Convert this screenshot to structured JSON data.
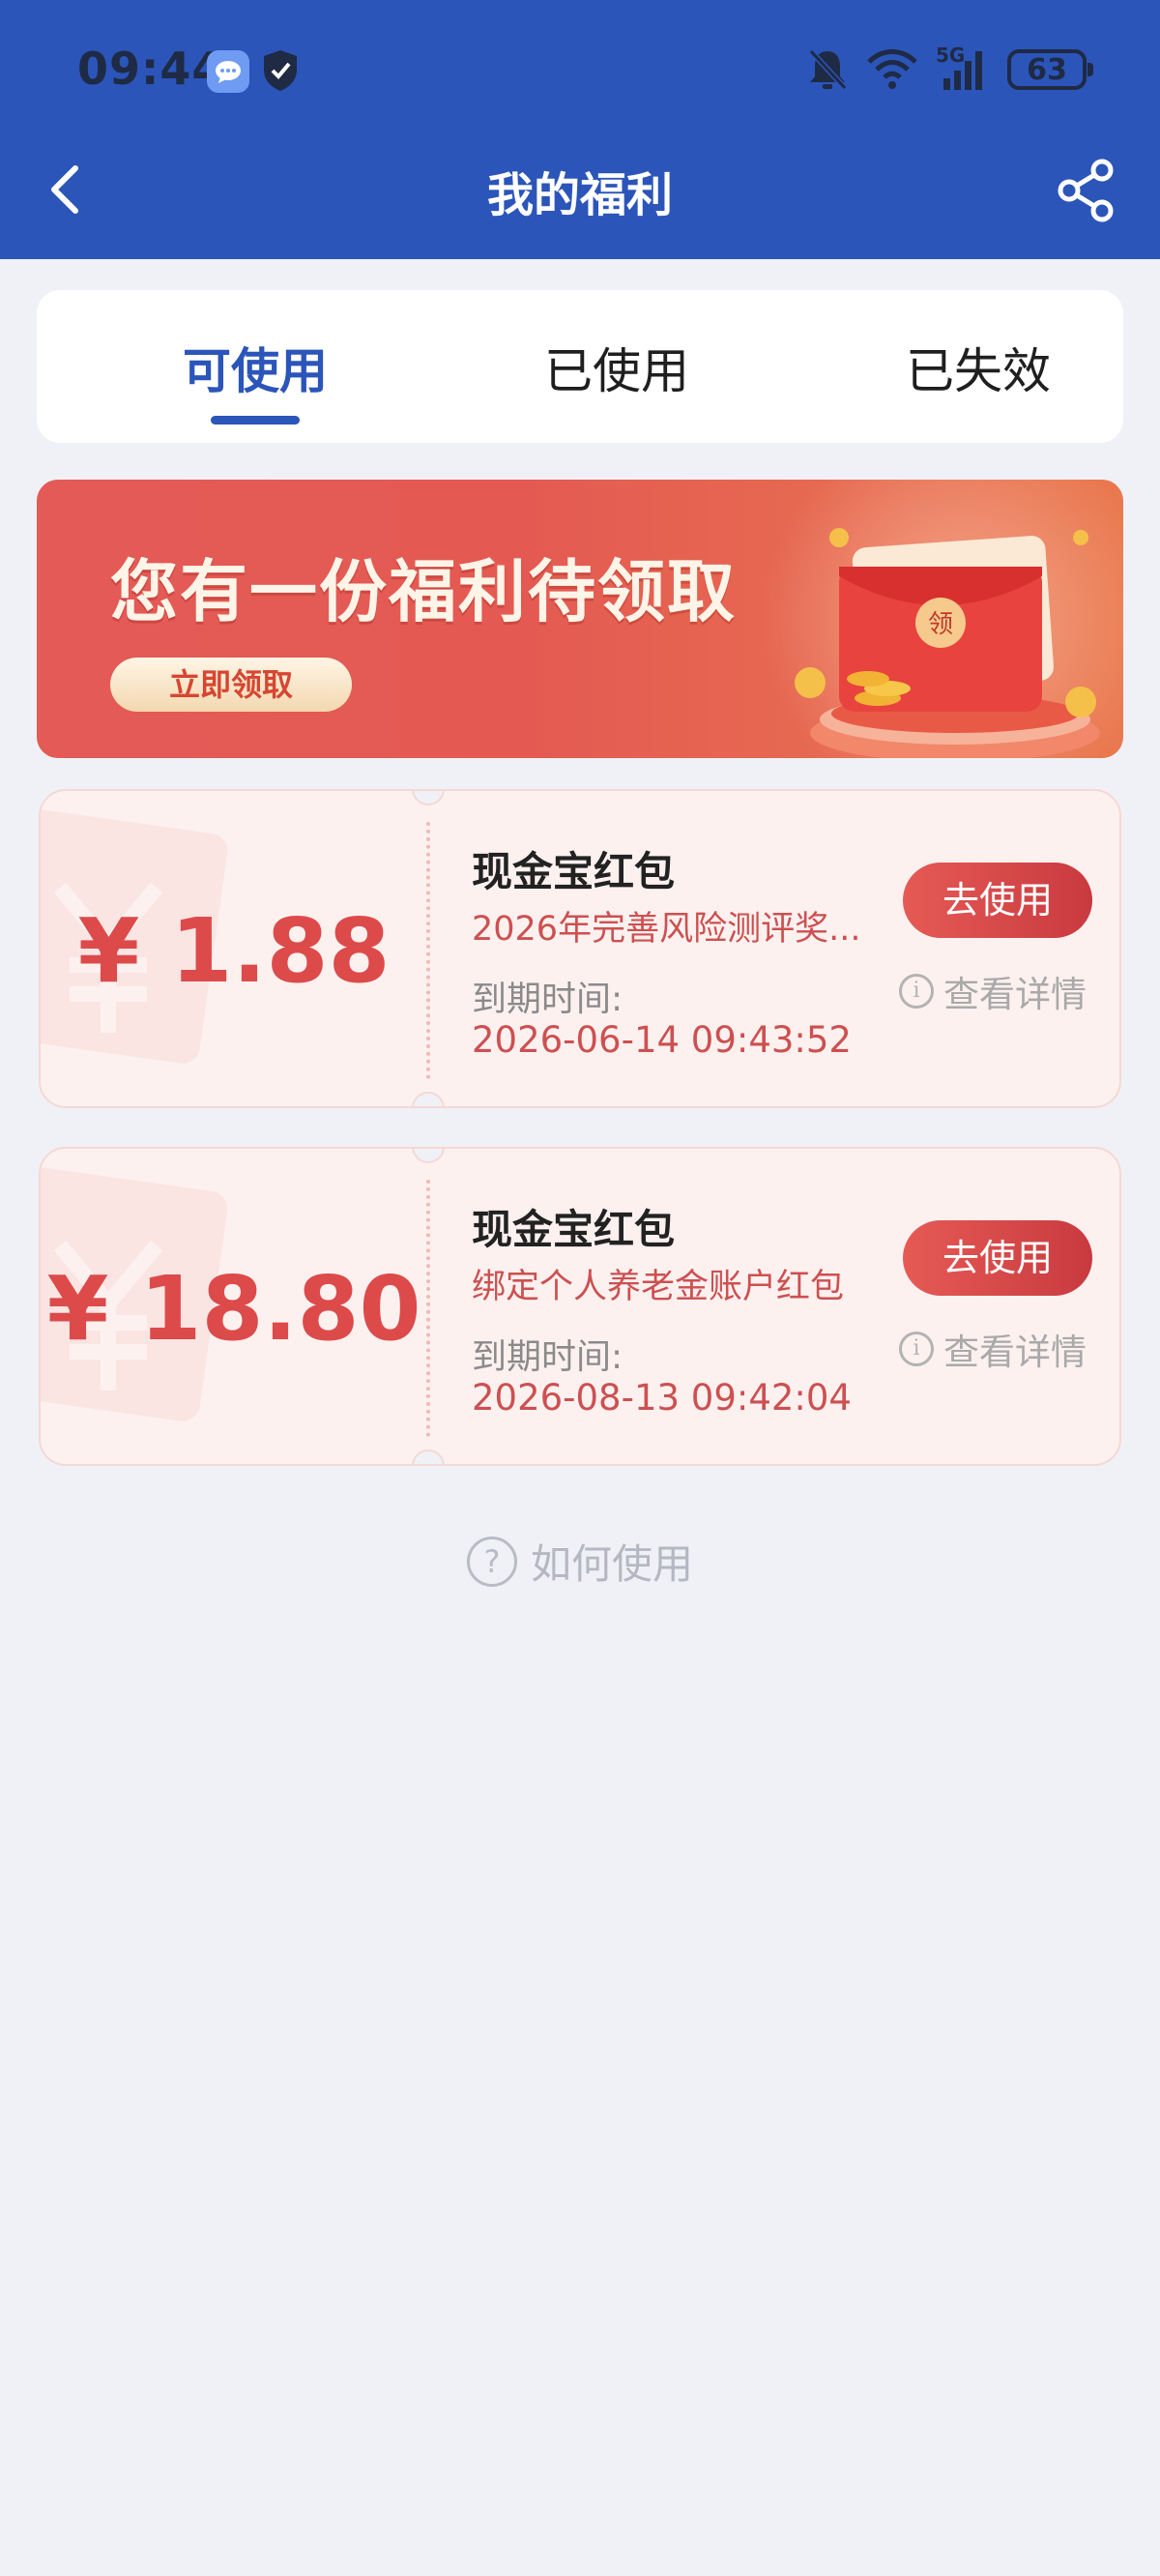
{
  "status_bar": {
    "time": "09:44",
    "battery": "63",
    "network": "5G",
    "icons": [
      "message-icon",
      "shield-icon",
      "bell-off-icon",
      "wifi-icon",
      "signal-icon",
      "battery-icon"
    ]
  },
  "nav": {
    "title": "我的福利",
    "back_icon": "chevron-left-icon",
    "share_icon": "share-icon"
  },
  "tabs": [
    {
      "label": "可使用",
      "active": true
    },
    {
      "label": "已使用",
      "active": false
    },
    {
      "label": "已失效",
      "active": false
    }
  ],
  "banner": {
    "title": "您有一份福利待领取",
    "button_label": "立即领取",
    "envelope_char": "领"
  },
  "coupons": [
    {
      "amount": "¥ 1.88",
      "title": "现金宝红包",
      "desc": "2026年完善风险测评奖...",
      "expire_label": "到期时间:",
      "expire_value": "2026-06-14 09:43:52",
      "use_label": "去使用",
      "detail_label": "查看详情"
    },
    {
      "amount": "¥ 18.80",
      "title": "现金宝红包",
      "desc": "绑定个人养老金账户红包",
      "expire_label": "到期时间:",
      "expire_value": "2026-08-13 09:42:04",
      "use_label": "去使用",
      "detail_label": "查看详情"
    }
  ],
  "howto": {
    "label": "如何使用",
    "icon": "question-icon"
  },
  "colors": {
    "brand_blue": "#2b55b9",
    "coupon_red": "#dd4a4a",
    "background": "#f0f1f6"
  }
}
